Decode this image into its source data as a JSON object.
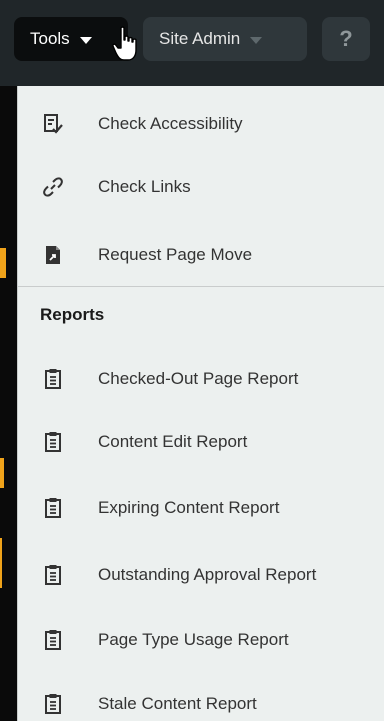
{
  "toolbar": {
    "tools_label": "Tools",
    "site_admin_label": "Site Admin",
    "help_label": "?"
  },
  "menu": {
    "items": [
      {
        "label": "Check Accessibility",
        "icon": "accessibility-check-icon"
      },
      {
        "label": "Check Links",
        "icon": "link-icon"
      },
      {
        "label": "Request Page Move",
        "icon": "page-move-icon"
      }
    ],
    "reports_heading": "Reports",
    "reports": [
      {
        "label": "Checked-Out Page Report",
        "icon": "report-icon"
      },
      {
        "label": "Content Edit Report",
        "icon": "report-icon"
      },
      {
        "label": "Expiring Content Report",
        "icon": "report-icon"
      },
      {
        "label": "Outstanding Approval Report",
        "icon": "report-icon"
      },
      {
        "label": "Page Type Usage Report",
        "icon": "report-icon"
      },
      {
        "label": "Stale Content Report",
        "icon": "report-icon"
      }
    ]
  },
  "colors": {
    "toolbar_bg": "#202629",
    "active_button_bg": "#0b0d0e",
    "button_bg": "#2f373b",
    "menu_bg": "#ecf0ef",
    "accent_strip": "#f0a31a"
  }
}
